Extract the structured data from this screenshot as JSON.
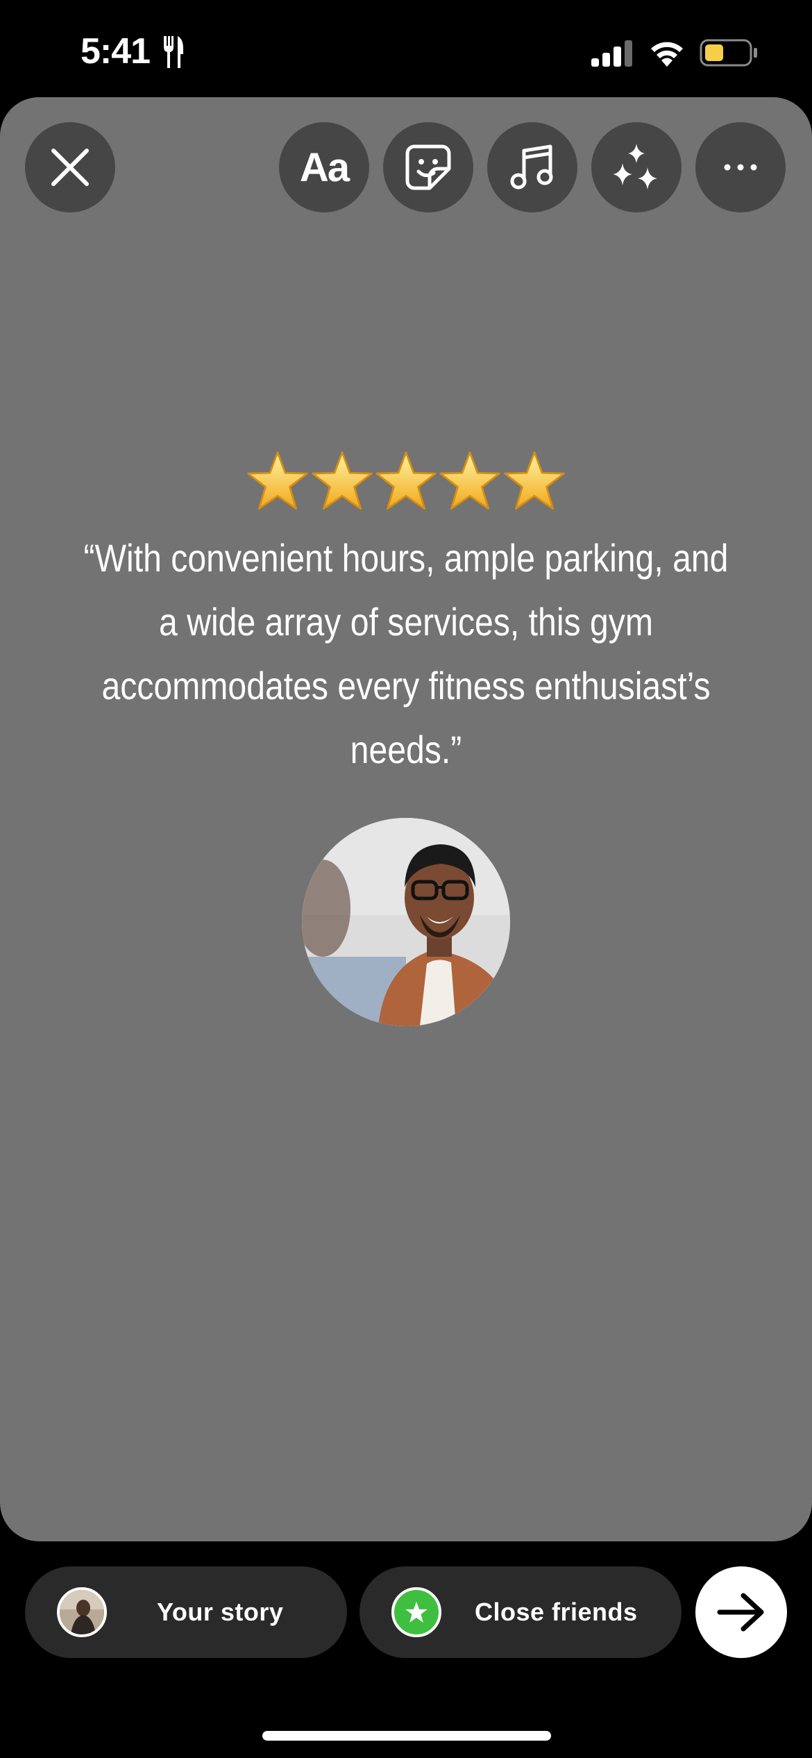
{
  "status_bar": {
    "time": "5:41",
    "icons": [
      "fork-knife-icon",
      "signal-icon",
      "wifi-icon",
      "battery-icon"
    ],
    "battery_level": 0.35,
    "battery_color": "#F5CF4A"
  },
  "toolbar": {
    "close_icon": "close-icon",
    "text_label": "Aa",
    "sticker_icon": "sticker-icon",
    "music_icon": "music-icon",
    "effects_icon": "sparkles-icon",
    "more_icon": "more-icon"
  },
  "story": {
    "background_color": "#737373",
    "rating": 5,
    "quote": "“With convenient hours, ample parking, and a wide array of services, this gym accommodates every fitness enthusiast’s needs.”",
    "photo": "smiling-man-avatar"
  },
  "bottom": {
    "your_story_label": "Your story",
    "close_friends_label": "Close friends",
    "close_friends_color": "#3FBF3F",
    "next_icon": "arrow-right-icon"
  }
}
